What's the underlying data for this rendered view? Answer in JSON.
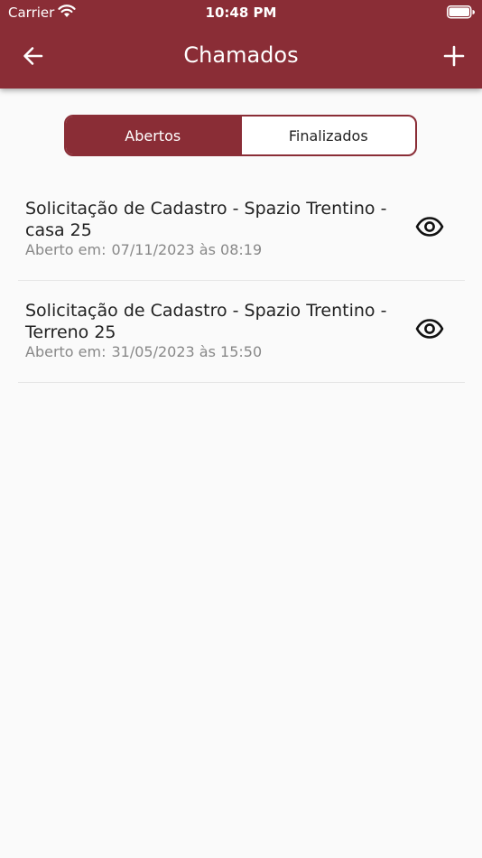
{
  "status_bar": {
    "carrier": "Carrier",
    "time": "10:48 PM"
  },
  "header": {
    "title": "Chamados",
    "back_icon": "arrow-left-icon",
    "add_icon": "plus-icon"
  },
  "tabs": [
    {
      "label": "Abertos",
      "active": true
    },
    {
      "label": "Finalizados",
      "active": false
    }
  ],
  "tickets": [
    {
      "title": "Solicitação de Cadastro - Spazio Trentino - casa 25",
      "opened_label": "Aberto em:",
      "opened_at": "07/11/2023 às 08:19"
    },
    {
      "title": "Solicitação de Cadastro - Spazio Trentino - Terreno 25",
      "opened_label": "Aberto em:",
      "opened_at": "31/05/2023 às 15:50"
    }
  ],
  "colors": {
    "brand": "#8a2d36",
    "background": "#fafafa",
    "muted_text": "#888888"
  }
}
